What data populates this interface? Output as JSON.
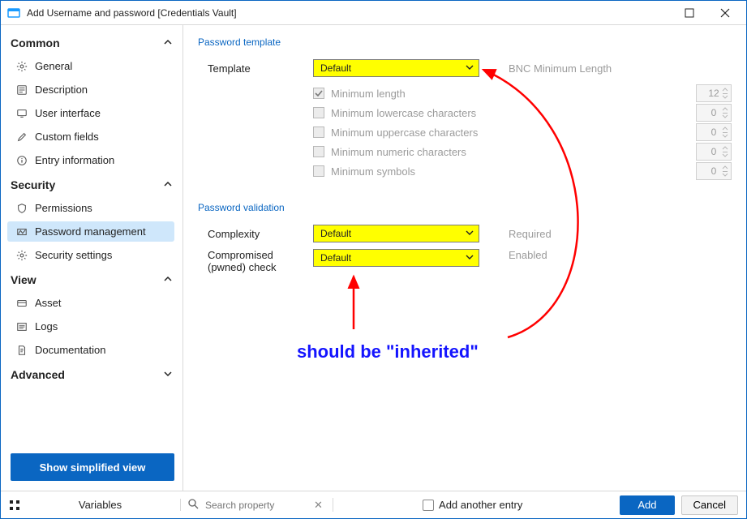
{
  "window": {
    "title": "Add Username and password [Credentials Vault]"
  },
  "sidebar": {
    "sections": {
      "common": {
        "label": "Common",
        "items": [
          {
            "label": "General",
            "icon": "gear"
          },
          {
            "label": "Description",
            "icon": "description"
          },
          {
            "label": "User interface",
            "icon": "monitor"
          },
          {
            "label": "Custom fields",
            "icon": "pencil"
          },
          {
            "label": "Entry information",
            "icon": "info"
          }
        ]
      },
      "security": {
        "label": "Security",
        "items": [
          {
            "label": "Permissions",
            "icon": "shield"
          },
          {
            "label": "Password management",
            "icon": "zigzag",
            "selected": true
          },
          {
            "label": "Security settings",
            "icon": "gear"
          }
        ]
      },
      "view": {
        "label": "View",
        "items": [
          {
            "label": "Asset",
            "icon": "asset"
          },
          {
            "label": "Logs",
            "icon": "logs"
          },
          {
            "label": "Documentation",
            "icon": "doc"
          }
        ]
      },
      "advanced": {
        "label": "Advanced"
      }
    },
    "simplified_button": "Show simplified view"
  },
  "panel": {
    "template_group_title": "Password template",
    "template_label": "Template",
    "template_value": "Default",
    "template_suffix": "BNC Minimum Length",
    "checks": [
      {
        "label": "Minimum length",
        "value": "12",
        "checked": true
      },
      {
        "label": "Minimum lowercase characters",
        "value": "0",
        "checked": false
      },
      {
        "label": "Minimum uppercase characters",
        "value": "0",
        "checked": false
      },
      {
        "label": "Minimum numeric characters",
        "value": "0",
        "checked": false
      },
      {
        "label": "Minimum symbols",
        "value": "0",
        "checked": false
      }
    ],
    "validation_group_title": "Password validation",
    "complexity_label": "Complexity",
    "complexity_value": "Default",
    "complexity_suffix": "Required",
    "pwned_label": "Compromised (pwned) check",
    "pwned_value": "Default",
    "pwned_suffix": "Enabled",
    "annotation": "should be \"inherited\""
  },
  "footer": {
    "variables_label": "Variables",
    "search_placeholder": "Search property",
    "add_another_label": "Add another entry",
    "add_button": "Add",
    "cancel_button": "Cancel"
  }
}
